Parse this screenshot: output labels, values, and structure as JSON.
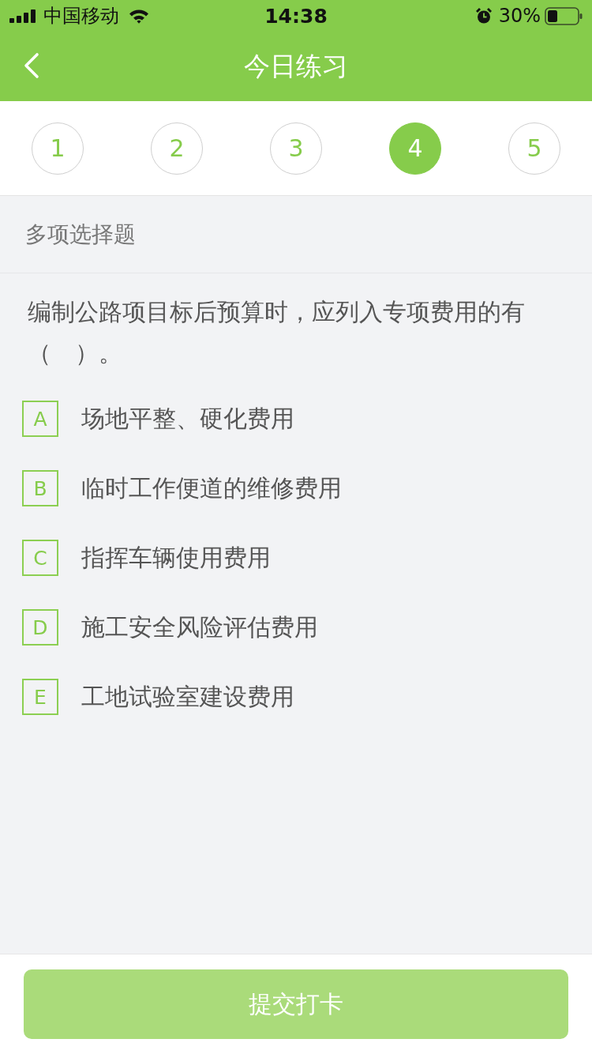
{
  "status_bar": {
    "carrier": "中国移动",
    "time": "14:38",
    "battery": "30%"
  },
  "nav": {
    "title": "今日练习"
  },
  "question_tabs": [
    {
      "label": "1",
      "selected": false
    },
    {
      "label": "2",
      "selected": false
    },
    {
      "label": "3",
      "selected": false
    },
    {
      "label": "4",
      "selected": true
    },
    {
      "label": "5",
      "selected": false
    }
  ],
  "section": {
    "title": "多项选择题"
  },
  "question": {
    "text": "编制公路项目标后预算时，应列入专项费用的有（　）。"
  },
  "options": [
    {
      "letter": "A",
      "text": "场地平整、硬化费用",
      "selected": false
    },
    {
      "letter": "B",
      "text": "临时工作便道的维修费用",
      "selected": false
    },
    {
      "letter": "C",
      "text": "指挥车辆使用费用",
      "selected": false
    },
    {
      "letter": "D",
      "text": "施工安全风险评估费用",
      "selected": false
    },
    {
      "letter": "E",
      "text": "工地试验室建设费用",
      "selected": false
    }
  ],
  "submit_button": {
    "label": "提交打卡",
    "disabled": true
  }
}
